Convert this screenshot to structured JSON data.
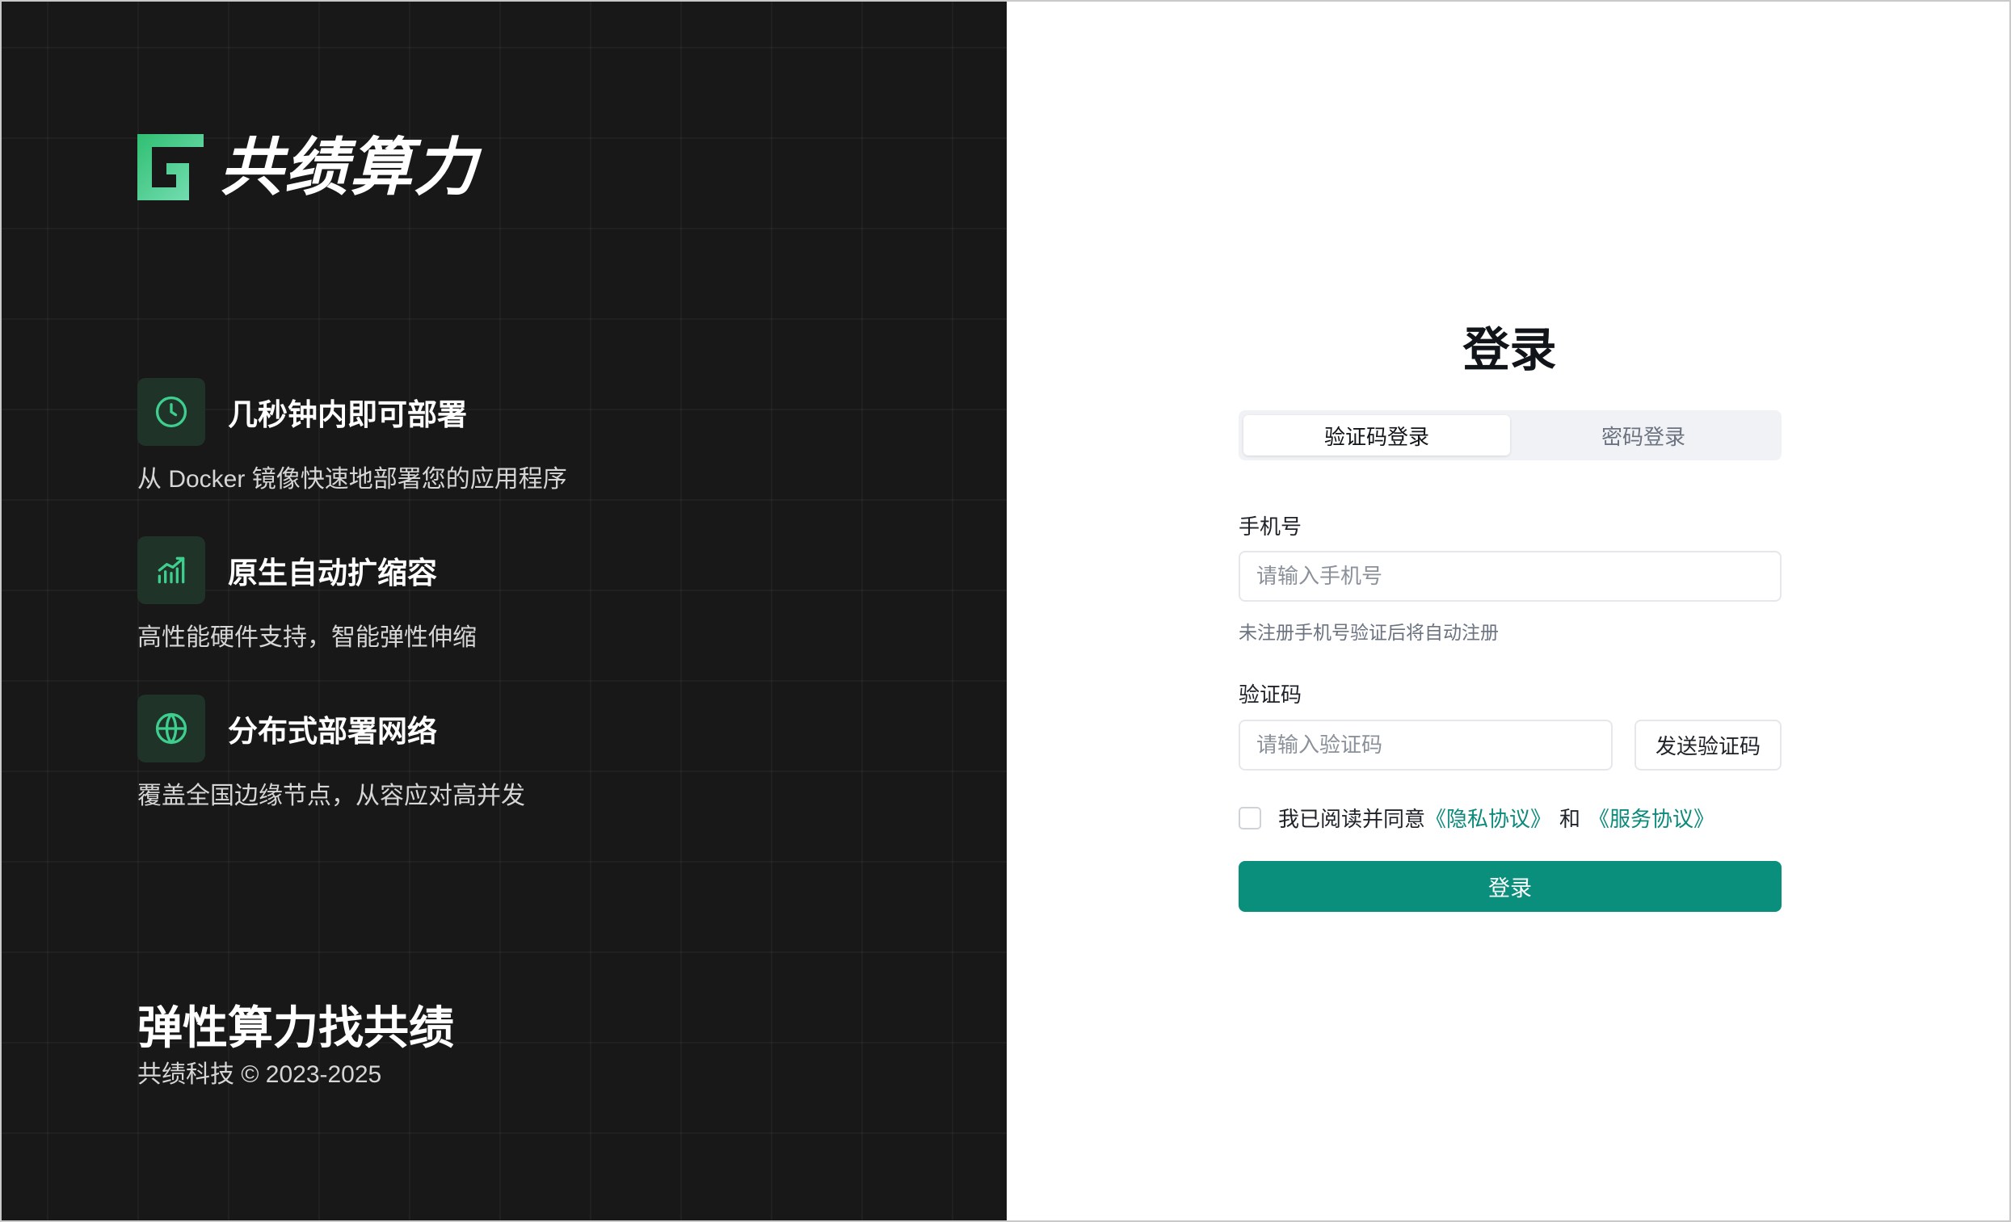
{
  "brand": {
    "name": "共绩算力",
    "accent_color": "#3ecf8e",
    "slogan": "弹性算力找共绩",
    "copyright": "共绩科技 © 2023-2025"
  },
  "features": [
    {
      "icon": "clock-icon",
      "title": "几秒钟内即可部署",
      "desc": "从 Docker 镜像快速地部署您的应用程序"
    },
    {
      "icon": "chart-growth-icon",
      "title": "原生自动扩缩容",
      "desc": "高性能硬件支持，智能弹性伸缩"
    },
    {
      "icon": "globe-icon",
      "title": "分布式部署网络",
      "desc": "覆盖全国边缘节点，从容应对高并发"
    }
  ],
  "login": {
    "title": "登录",
    "tabs": [
      {
        "label": "验证码登录",
        "active": true
      },
      {
        "label": "密码登录",
        "active": false
      }
    ],
    "phone": {
      "label": "手机号",
      "placeholder": "请输入手机号",
      "value": "",
      "hint": "未注册手机号验证后将自动注册"
    },
    "code": {
      "label": "验证码",
      "placeholder": "请输入验证码",
      "value": "",
      "send_label": "发送验证码"
    },
    "agreement": {
      "checked": false,
      "prefix": "我已阅读并同意",
      "privacy": "《隐私协议》",
      "and": "和",
      "service": "《服务协议》"
    },
    "submit_label": "登录",
    "primary_color": "#0b8f7d"
  }
}
